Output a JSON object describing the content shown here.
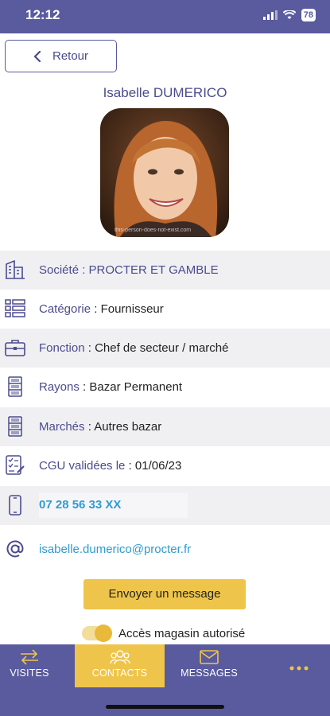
{
  "status_bar": {
    "time": "12:12",
    "battery": "78"
  },
  "back": {
    "label": "Retour"
  },
  "contact": {
    "name": "Isabelle DUMERICO",
    "photo_caption": "this-person-does-not-exist.com"
  },
  "rows": [
    {
      "label": "Société : ",
      "value": "PROCTER ET GAMBLE"
    },
    {
      "label": "Catégorie",
      "sep": " : ",
      "value": "Fournisseur"
    },
    {
      "label": "Fonction",
      "sep": " : ",
      "value": "Chef de secteur / marché"
    },
    {
      "label": "Rayons",
      "sep": " : ",
      "value": "Bazar Permanent"
    },
    {
      "label": "Marchés",
      "sep": " : ",
      "value": "Autres bazar"
    },
    {
      "label": "CGU validées le",
      "sep": " : ",
      "value": "01/06/23"
    },
    {
      "value": "07 28 56 33 XX"
    },
    {
      "value": "isabelle.dumerico@procter.fr"
    }
  ],
  "actions": {
    "send_message": "Envoyer un message",
    "store_access": "Accès magasin autorisé",
    "store_access_on": true
  },
  "tabs": [
    {
      "label": "VISITES",
      "icon": "swap-arrows-icon"
    },
    {
      "label": "CONTACTS",
      "icon": "people-icon",
      "active": true
    },
    {
      "label": "MESSAGES",
      "icon": "envelope-icon"
    },
    {
      "label": "",
      "icon": "more-dots-icon"
    }
  ],
  "colors": {
    "primary": "#5a5a9e",
    "accent": "#eec44a",
    "link": "#2f9bd3",
    "row_shade": "#f0f0f3"
  }
}
